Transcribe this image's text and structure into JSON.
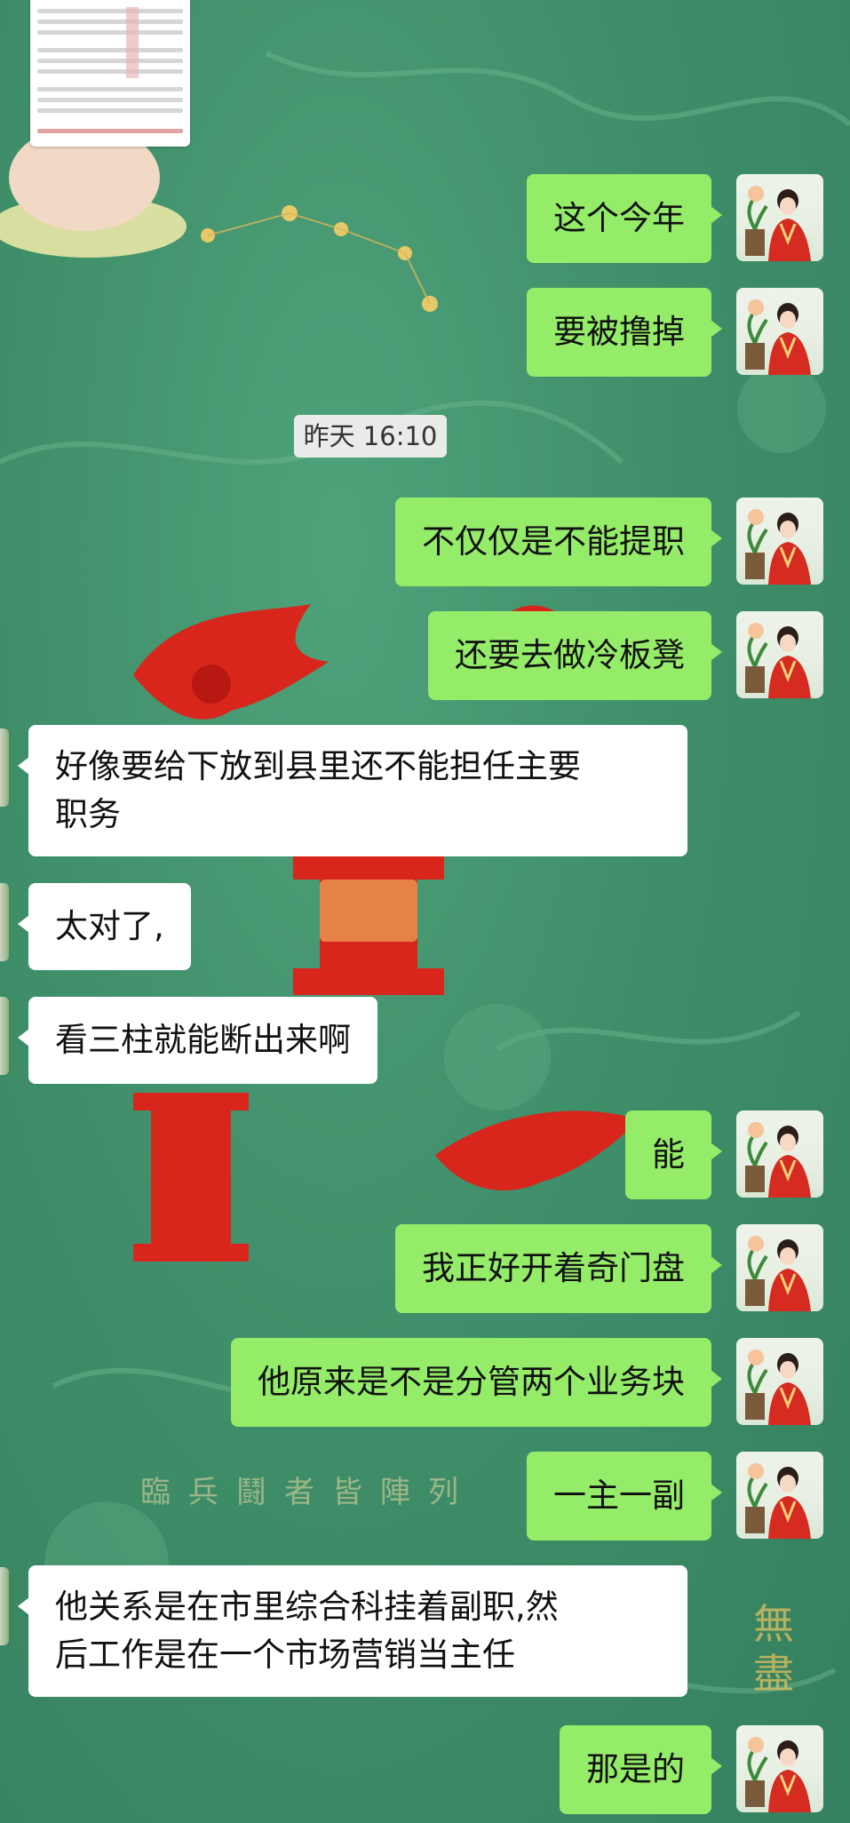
{
  "colors": {
    "background": "#3f8f6a",
    "my_bubble": "#95ec69",
    "their_bubble": "#ffffff",
    "timestamp_bg": "#e9ece9"
  },
  "shared_image": {
    "icon": "chart-table-image"
  },
  "timestamp": "昨天 16:10",
  "messages": [
    {
      "sender": "me",
      "text": "这个今年"
    },
    {
      "sender": "me",
      "text": "要被撸掉"
    },
    {
      "sender": "me",
      "text": "不仅仅是不能提职"
    },
    {
      "sender": "me",
      "text": "还要去做冷板凳"
    },
    {
      "sender": "them",
      "line1": "好像要给下放到县里还不能担任主要",
      "line2": "职务"
    },
    {
      "sender": "them",
      "text": "太对了,"
    },
    {
      "sender": "them",
      "text": "看三柱就能断出来啊"
    },
    {
      "sender": "me",
      "text": "能"
    },
    {
      "sender": "me",
      "text": "我正好开着奇门盘"
    },
    {
      "sender": "me",
      "text": "他原来是不是分管两个业务块"
    },
    {
      "sender": "me",
      "text": "一主一副"
    },
    {
      "sender": "them",
      "line1": "他关系是在市里综合科挂着副职,然",
      "line2": "后工作是在一个市场营销当主任"
    },
    {
      "sender": "me",
      "text": "那是的"
    }
  ],
  "wallpaper_text": {
    "caption": "臨兵鬪者皆陣列",
    "seal": "無盡"
  }
}
